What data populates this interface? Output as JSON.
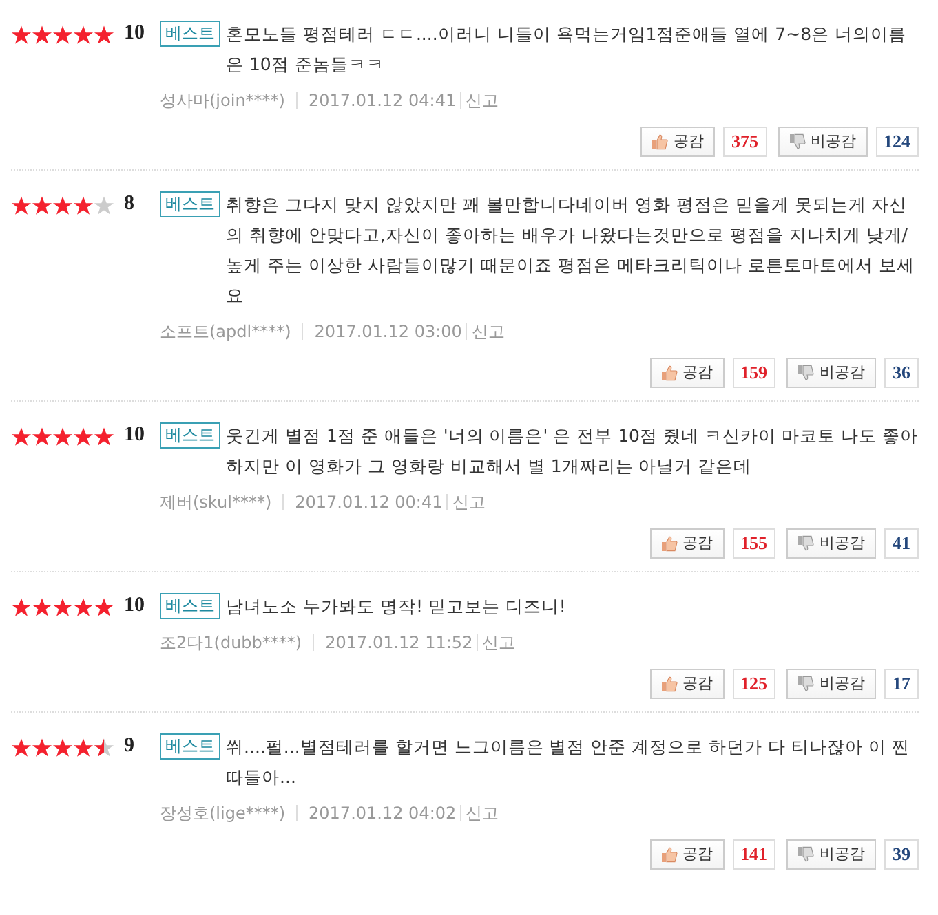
{
  "reviews": [
    {
      "stars": 5,
      "score": "10",
      "badge": "베스트",
      "text": "혼모노들 평점테러 ㄷㄷ....이러니 니들이 욕먹는거임1점준애들 열에 7~8은 너의이름은 10점 준놈들ㅋㅋ",
      "author": "성사마(join****)",
      "date": "2017.01.12 04:41",
      "report": "신고",
      "like_label": "공감",
      "likes": "375",
      "dislike_label": "비공감",
      "dislikes": "124"
    },
    {
      "stars": 4,
      "score": "8",
      "badge": "베스트",
      "text": "취향은 그다지 맞지 않았지만 꽤 볼만합니다네이버 영화 평점은 믿을게 못되는게 자신의 취향에 안맞다고,자신이 좋아하는 배우가 나왔다는것만으로 평점을 지나치게 낮게/높게 주는 이상한 사람들이많기 때문이죠 평점은 메타크리틱이나 로튼토마토에서 보세요",
      "author": "소프트(apdl****)",
      "date": "2017.01.12 03:00",
      "report": "신고",
      "like_label": "공감",
      "likes": "159",
      "dislike_label": "비공감",
      "dislikes": "36"
    },
    {
      "stars": 5,
      "score": "10",
      "badge": "베스트",
      "text": "웃긴게 별점 1점 준 애들은 '너의 이름은' 은 전부 10점 줬네 ㅋ신카이 마코토 나도 좋아하지만 이 영화가 그 영화랑 비교해서 별 1개짜리는 아닐거 같은데",
      "author": "제버(skul****)",
      "date": "2017.01.12 00:41",
      "report": "신고",
      "like_label": "공감",
      "likes": "155",
      "dislike_label": "비공감",
      "dislikes": "41"
    },
    {
      "stars": 5,
      "score": "10",
      "badge": "베스트",
      "text": "남녀노소 누가봐도 명작! 믿고보는 디즈니!",
      "author": "조2다1(dubb****)",
      "date": "2017.01.12 11:52",
      "report": "신고",
      "like_label": "공감",
      "likes": "125",
      "dislike_label": "비공감",
      "dislikes": "17"
    },
    {
      "stars": 4.5,
      "score": "9",
      "badge": "베스트",
      "text": "쒸....펄...별점테러를 할거면 느그이름은 별점 안준 계정으로 하던가 다 티나잖아 이 찐따들아...",
      "author": "장성호(lige****)",
      "date": "2017.01.12 04:02",
      "report": "신고",
      "like_label": "공감",
      "likes": "141",
      "dislike_label": "비공감",
      "dislikes": "39"
    }
  ]
}
